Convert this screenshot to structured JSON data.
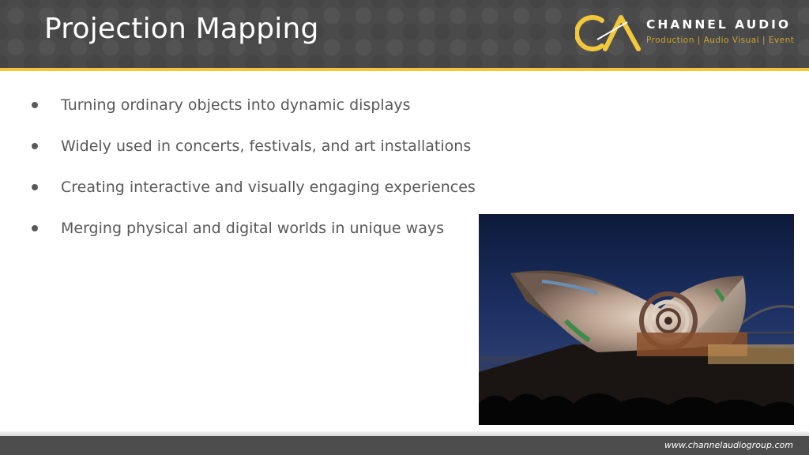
{
  "slide": {
    "title": "Projection Mapping"
  },
  "logo": {
    "name": "CHANNEL AUDIO",
    "tagline": "Production | Audio Visual | Event"
  },
  "bullets": [
    "Turning ordinary objects into dynamic displays",
    "Widely used in concerts, festivals, and art installations",
    "Creating interactive and visually engaging experiences",
    "Merging physical and digital worlds in unique ways"
  ],
  "footer": {
    "url": "www.channelaudiogroup.com"
  },
  "colors": {
    "header_bg": "#4a4a4a",
    "accent": "#f2c83a",
    "body_text": "#595959",
    "footer_bg": "#4d4d4d"
  }
}
